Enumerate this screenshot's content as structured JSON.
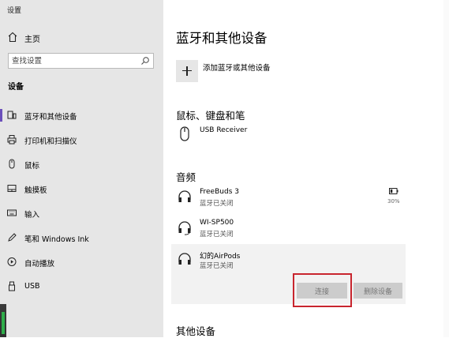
{
  "window": {
    "title": "设置"
  },
  "sidebar": {
    "home_label": "主页",
    "search_placeholder": "查找设置",
    "section_label": "设备",
    "items": [
      {
        "label": "蓝牙和其他设备",
        "icon": "bluetooth-devices-icon",
        "active": true
      },
      {
        "label": "打印机和扫描仪",
        "icon": "printer-icon"
      },
      {
        "label": "鼠标",
        "icon": "mouse-icon"
      },
      {
        "label": "触摸板",
        "icon": "touchpad-icon"
      },
      {
        "label": "输入",
        "icon": "keyboard-icon"
      },
      {
        "label": "笔和 Windows Ink",
        "icon": "pen-icon"
      },
      {
        "label": "自动播放",
        "icon": "autoplay-icon"
      },
      {
        "label": "USB",
        "icon": "usb-icon"
      }
    ]
  },
  "main": {
    "title": "蓝牙和其他设备",
    "add_device_label": "添加蓝牙或其他设备",
    "sections": {
      "mouse_keyboard_pen": "鼠标、键盘和笔",
      "audio": "音频",
      "other_devices": "其他设备"
    },
    "mouse_devices": [
      {
        "name": "USB Receiver",
        "icon": "mouse-icon"
      }
    ],
    "audio_devices": [
      {
        "name": "FreeBuds 3",
        "status": "蓝牙已关闭",
        "battery": "30%",
        "icon": "headphones-icon"
      },
      {
        "name": "WI-SP500",
        "status": "蓝牙已关闭",
        "icon": "headset-icon"
      },
      {
        "name": "幻的AirPods",
        "status": "蓝牙已关闭",
        "icon": "headphones-icon",
        "selected": true
      }
    ],
    "buttons": {
      "connect": "连接",
      "remove": "删除设备"
    }
  },
  "colors": {
    "accent": "#6b4fbb",
    "highlight": "#c8252e",
    "sidebar_bg": "#e6e6e6"
  }
}
